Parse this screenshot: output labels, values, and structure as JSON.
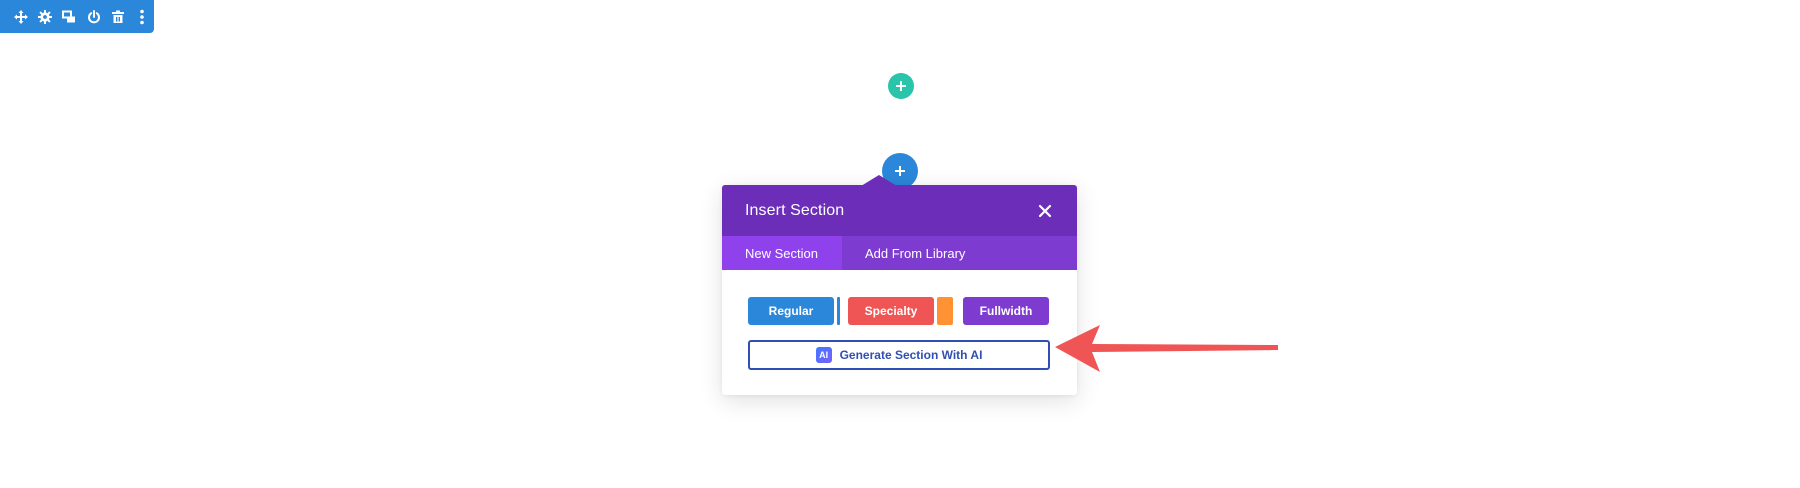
{
  "toolbar": {
    "icons": [
      "move-icon",
      "gear-icon",
      "duplicate-icon",
      "power-icon",
      "trash-icon",
      "more-vertical-icon"
    ],
    "color": "#2b87da"
  },
  "add_row_button": {
    "symbol": "+",
    "color": "#29c4a9"
  },
  "add_section_button": {
    "symbol": "+",
    "color": "#2b87da"
  },
  "modal": {
    "title": "Insert Section",
    "close_symbol": "✕",
    "tabs": [
      {
        "label": "New Section",
        "active": true
      },
      {
        "label": "Add From Library",
        "active": false
      }
    ],
    "buttons": {
      "regular": "Regular",
      "specialty": "Specialty",
      "fullwidth": "Fullwidth"
    },
    "ai_button": {
      "badge": "AI",
      "label": "Generate Section With AI"
    },
    "colors": {
      "header": "#6c2eb9",
      "tabs": "#7e3bd0",
      "active_tab": "#8f42ec",
      "regular": "#2b87da",
      "specialty": "#ef5555",
      "specialty_accent": "#ff9232",
      "fullwidth": "#7e3bd0",
      "ai_border": "#2f4fb3"
    }
  },
  "annotation": {
    "arrow_color": "#ef5555"
  }
}
